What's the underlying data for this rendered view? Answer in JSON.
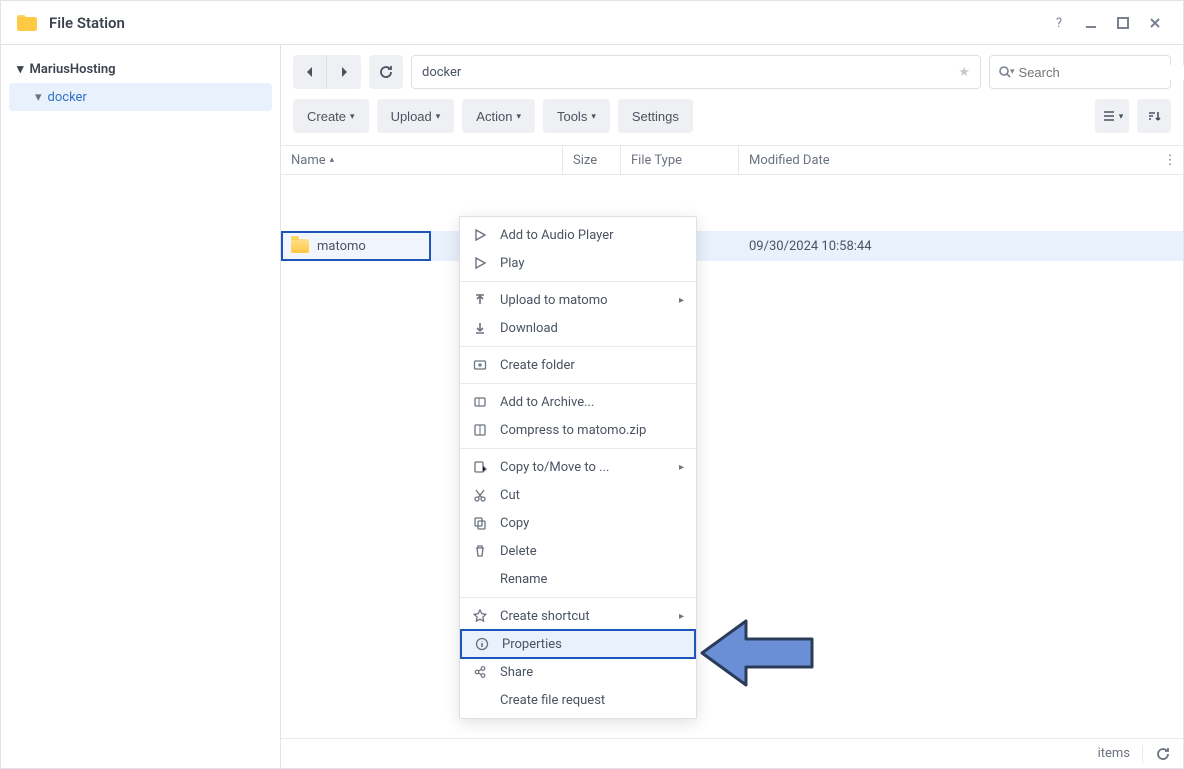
{
  "app": {
    "title": "File Station"
  },
  "sidebar": {
    "root": "MariusHosting",
    "child": "docker"
  },
  "toolbar": {
    "path": "docker",
    "search_placeholder": "Search",
    "create": "Create",
    "upload": "Upload",
    "action": "Action",
    "tools": "Tools",
    "settings": "Settings"
  },
  "columns": {
    "name": "Name",
    "size": "Size",
    "type": "File Type",
    "date": "Modified Date"
  },
  "row": {
    "name": "matomo",
    "date": "09/30/2024 10:58:44"
  },
  "menu": {
    "add_audio": "Add to Audio Player",
    "play": "Play",
    "upload_to": "Upload to matomo",
    "download": "Download",
    "create_folder": "Create folder",
    "add_archive": "Add to Archive...",
    "compress": "Compress to matomo.zip",
    "copymove": "Copy to/Move to ...",
    "cut": "Cut",
    "copy": "Copy",
    "delete": "Delete",
    "rename": "Rename",
    "shortcut": "Create shortcut",
    "properties": "Properties",
    "share": "Share",
    "file_request": "Create file request"
  },
  "status": {
    "items": "items"
  }
}
